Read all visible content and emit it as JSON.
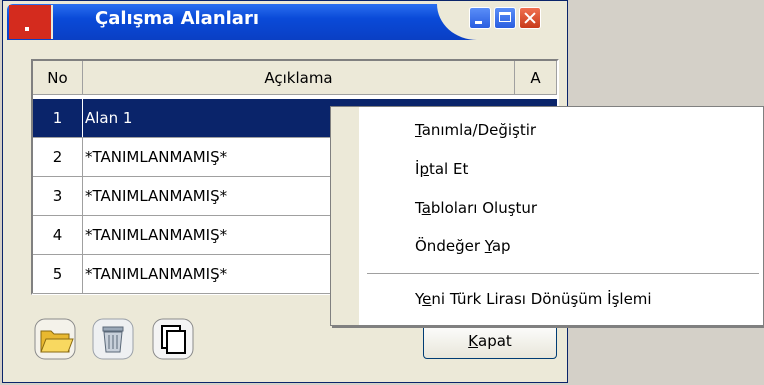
{
  "window": {
    "title": "Çalışma Alanları",
    "controls": {
      "minimize": "minimize-icon",
      "maximize": "maximize-icon",
      "close": "close-icon"
    }
  },
  "grid": {
    "columns": [
      "No",
      "Açıklama",
      "A"
    ],
    "rows": [
      {
        "no": "1",
        "desc": "Alan 1",
        "selected": true
      },
      {
        "no": "2",
        "desc": "*TANIMLANMAMIŞ*"
      },
      {
        "no": "3",
        "desc": "*TANIMLANMAMIŞ*"
      },
      {
        "no": "4",
        "desc": "*TANIMLANMAMIŞ*"
      },
      {
        "no": "5",
        "desc": "*TANIMLANMAMIŞ*"
      }
    ]
  },
  "toolbar": {
    "icons": [
      "folder-open-icon",
      "trash-icon",
      "copy-icon"
    ],
    "close_button": {
      "pre": "",
      "u": "K",
      "post": "apat"
    }
  },
  "context_menu": {
    "items": [
      {
        "pre": "",
        "u": "T",
        "post": "anımla/Değiştir"
      },
      {
        "pre": "İ",
        "u": "p",
        "post": "tal Et"
      },
      {
        "pre": "T",
        "u": "a",
        "post": "bloları Oluştur"
      },
      {
        "pre": "Öndeğer ",
        "u": "Y",
        "post": "ap"
      },
      {
        "pre": "Y",
        "u": "e",
        "post": "ni Türk Lirası Dönüşüm İşlemi"
      }
    ]
  },
  "colors": {
    "titlebar": "#0a4ad8",
    "selection": "#0a246a",
    "window_bg": "#ece9d8"
  }
}
